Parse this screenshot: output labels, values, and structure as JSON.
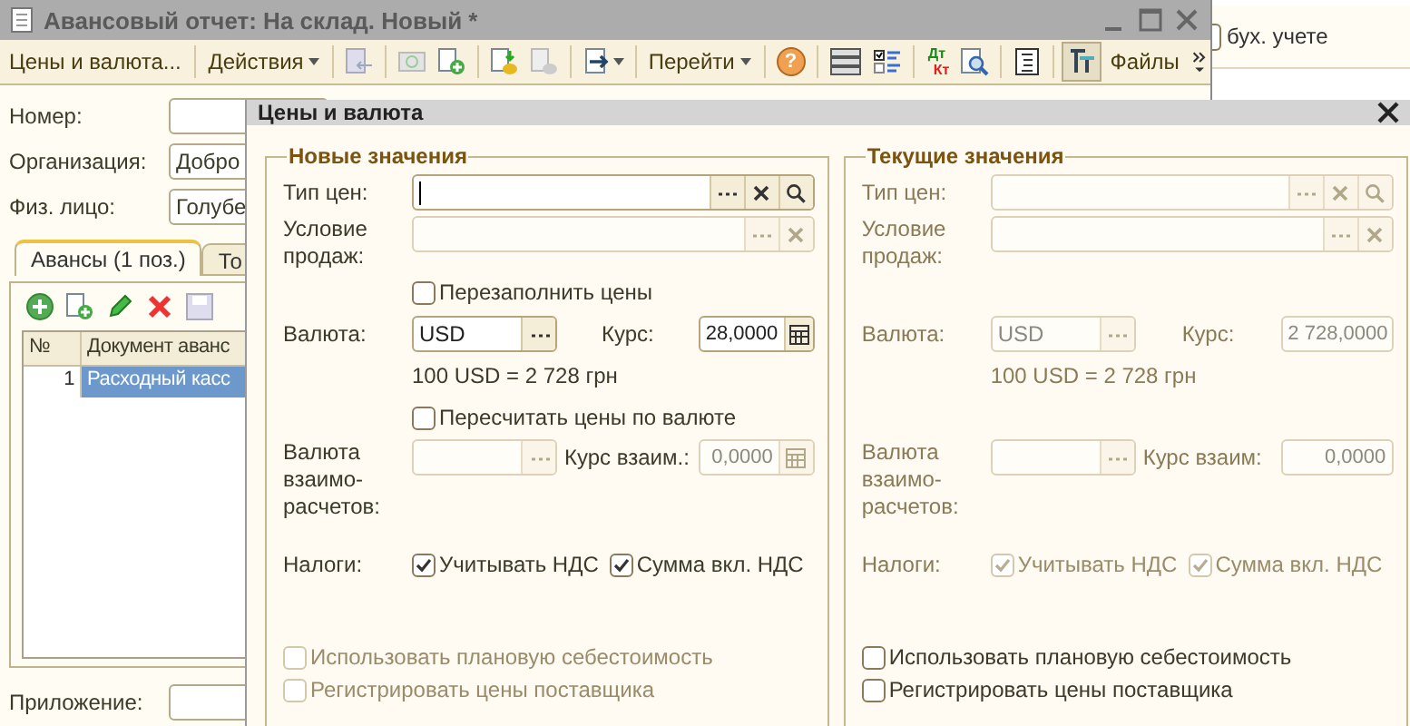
{
  "main_window": {
    "title": "Авансовый отчет: На склад. Новый *",
    "toolbar": {
      "prices_button": "Цены и валюта...",
      "actions_menu": "Действия",
      "goto_menu": "Перейти",
      "help_button": "?",
      "posting_button": {
        "debit": "Дт",
        "credit": "Кт"
      },
      "files_button": "Файлы"
    },
    "fields": [
      {
        "label": "Номер:"
      },
      {
        "label": "Организация:",
        "value": "Добро"
      },
      {
        "label": "Физ. лицо:",
        "value": "Голубе"
      }
    ],
    "tabs": [
      {
        "label": "Авансы (1 поз.)",
        "selected": true
      },
      {
        "label": "То",
        "selected": false
      }
    ],
    "table": {
      "columns": [
        "№",
        "Документ аванс"
      ],
      "rows": [
        {
          "cells": [
            "1",
            "Расходный касс"
          ],
          "selected": true
        }
      ]
    },
    "attachment": {
      "label": "Приложение:"
    }
  },
  "side_window": {
    "text": "бух. учете",
    "checked": false
  },
  "dialog": {
    "title": "Цены и валюта",
    "groups": [
      {
        "title": "Новые значения",
        "disabled": false,
        "price_type": {
          "label": "Тип цен:",
          "focused": true,
          "disabled": false
        },
        "sales_condition": {
          "label": "Условие продаж:",
          "disabled": true
        },
        "refill_prices": {
          "label": "Перезаполнить цены",
          "checked": false
        },
        "currency": {
          "label": "Валюта:",
          "value": "USD",
          "disabled": false
        },
        "rate": {
          "label": "Курс:",
          "value": "28,0000",
          "calculator": true,
          "disabled": false
        },
        "rate_note": "100 USD = 2 728 грн",
        "recalc_prices": {
          "label": "Пересчитать цены по валюте",
          "checked": false
        },
        "settlement_currency": {
          "label": "Валюта взаимо-расчетов:",
          "disabled": true
        },
        "settlement_rate": {
          "label": "Курс взаим.:",
          "value": "0,0000",
          "disabled": true,
          "calculator": true
        },
        "taxes": {
          "label": "Налоги:",
          "options": [
            {
              "label": "Учитывать НДС",
              "checked": true
            },
            {
              "label": "Сумма вкл. НДС",
              "checked": true
            }
          ]
        },
        "options": [
          {
            "label": "Использовать плановую себестоимость",
            "checked": false,
            "disabled": true
          },
          {
            "label": "Регистрировать цены поставщика",
            "checked": false,
            "disabled": true
          }
        ]
      },
      {
        "title": "Текущие значения",
        "disabled": true,
        "price_type": {
          "label": "Тип цен:",
          "focused": false,
          "disabled": true
        },
        "sales_condition": {
          "label": "Условие продаж:",
          "disabled": true
        },
        "currency": {
          "label": "Валюта:",
          "value": "USD",
          "disabled": true
        },
        "rate": {
          "label": "Курс:",
          "value": "2 728,0000",
          "calculator": false,
          "disabled": true
        },
        "rate_note": "100 USD = 2 728 грн",
        "settlement_currency": {
          "label": "Валюта взаимо-расчетов:",
          "disabled": true
        },
        "settlement_rate": {
          "label": "Курс взаим:",
          "value": "0,0000",
          "disabled": true,
          "calculator": false
        },
        "taxes": {
          "label": "Налоги:",
          "options": [
            {
              "label": "Учитывать НДС",
              "checked": true
            },
            {
              "label": "Сумма вкл. НДС",
              "checked": true
            }
          ]
        },
        "options": [
          {
            "label": "Использовать плановую себестоимость",
            "checked": false,
            "disabled": false
          },
          {
            "label": "Регистрировать цены поставщика",
            "checked": false,
            "disabled": false
          }
        ]
      }
    ]
  }
}
